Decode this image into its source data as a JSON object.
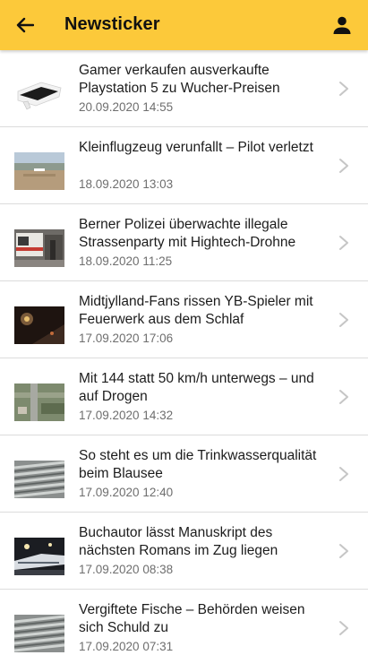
{
  "appbar": {
    "title": "Newsticker",
    "back_icon": "arrow-left-icon",
    "profile_icon": "person-icon",
    "background": "#fcc93a"
  },
  "articles": [
    {
      "headline": "Gamer verkaufen ausverkaufte Playstation 5 zu Wucher-Preisen",
      "date": "20.09.2020 14:55"
    },
    {
      "headline": "Kleinflugzeug verunfallt – Pilot verletzt",
      "date": "18.09.2020 13:03"
    },
    {
      "headline": "Berner Polizei überwachte illegale Strassenparty mit Hightech-Drohne",
      "date": "18.09.2020 11:25"
    },
    {
      "headline": "Midtjylland-Fans rissen YB-Spieler mit Feuerwerk aus dem Schlaf",
      "date": "17.09.2020 17:06"
    },
    {
      "headline": "Mit 144 statt 50 km/h unterwegs – und auf Drogen",
      "date": "17.09.2020 14:32"
    },
    {
      "headline": "So steht es um die Trinkwasserqualität beim Blausee",
      "date": "17.09.2020 12:40"
    },
    {
      "headline": "Buchautor lässt Manuskript des nächsten Romans im Zug liegen",
      "date": "17.09.2020 08:38"
    },
    {
      "headline": "Vergiftete Fische – Behörden weisen sich Schuld zu",
      "date": "17.09.2020 07:31"
    }
  ]
}
